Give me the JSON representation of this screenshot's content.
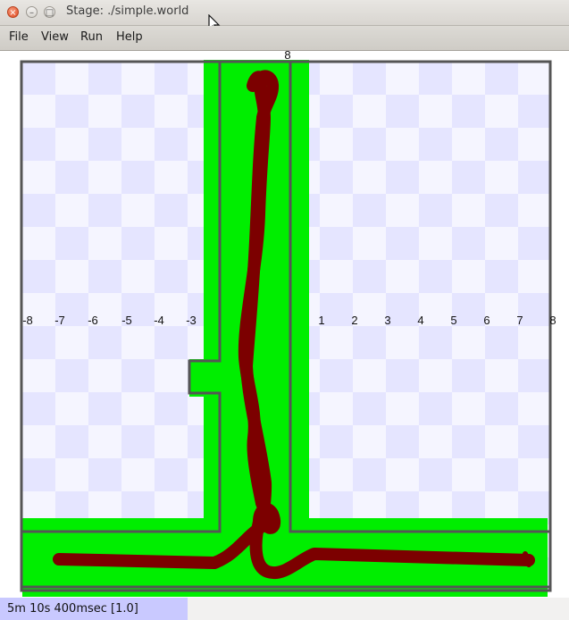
{
  "window": {
    "title": "Stage: ./simple.world"
  },
  "menu": [
    "File",
    "View",
    "Run",
    "Help"
  ],
  "axis": {
    "x_labels": [
      "-8",
      "-7",
      "-6",
      "-5",
      "-4",
      "-3",
      "1",
      "2",
      "3",
      "4",
      "5",
      "6",
      "7",
      "8"
    ],
    "y_top_label": "8"
  },
  "status": {
    "text": "5m 10s 400msec [1.0]"
  },
  "colors": {
    "floor_light": "#f5f5ff",
    "floor_dark": "#e5e5ff",
    "free_space": "#00ee00",
    "wall": "#555555",
    "trail": "#7c0000",
    "status_bg": "#c9c9ff"
  }
}
